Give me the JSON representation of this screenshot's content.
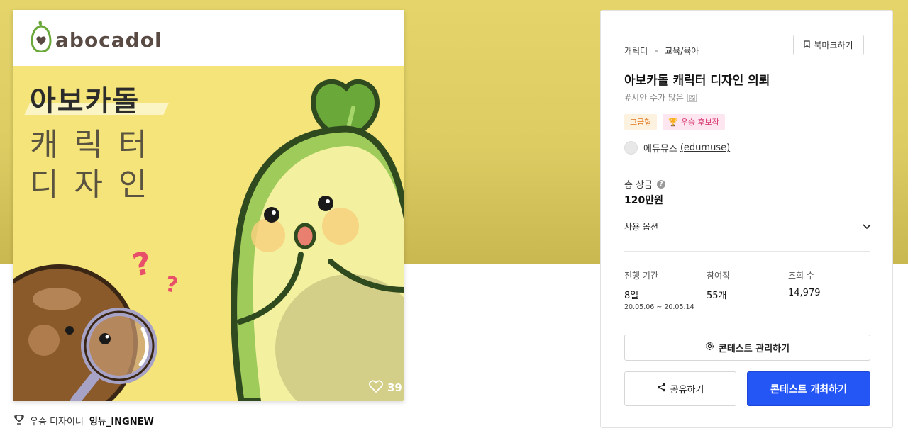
{
  "brand": {
    "logo_text": "abocadol"
  },
  "artwork": {
    "title_line1": "아보카돌",
    "title_line2": "캐릭터",
    "title_line3": "디자인",
    "likes": "39"
  },
  "winner": {
    "label": "우승 디자이너",
    "name": "잉뉴_INGNEW"
  },
  "contest": {
    "category": "캐릭터",
    "subcategory": "교육/육아",
    "bookmark_label": "북마크하기",
    "title": "아보카돌 캐릭터 디자인 의뢰",
    "tagline": "#시안 수가 많은 🖼",
    "badges": [
      "고급형",
      "우승 후보작"
    ],
    "host_name": "에듀뮤즈",
    "host_id": "(edumuse)",
    "prize_label": "총 상금",
    "prize_value": "120만원",
    "usage_label": "사용 옵션",
    "stats": {
      "period_label": "진행 기간",
      "period_value": "8일",
      "period_dates": "20.05.06 ~ 20.05.14",
      "entries_label": "참여작",
      "entries_value": "55개",
      "views_label": "조회 수",
      "views_value": "14,979"
    },
    "manage_label": "콘테스트 관리하기",
    "share_label": "공유하기",
    "open_label": "콘테스트 개최하기"
  },
  "colors": {
    "primary": "#2456f5",
    "banner": "#e2d26a",
    "art_bg": "#f4e47a"
  }
}
